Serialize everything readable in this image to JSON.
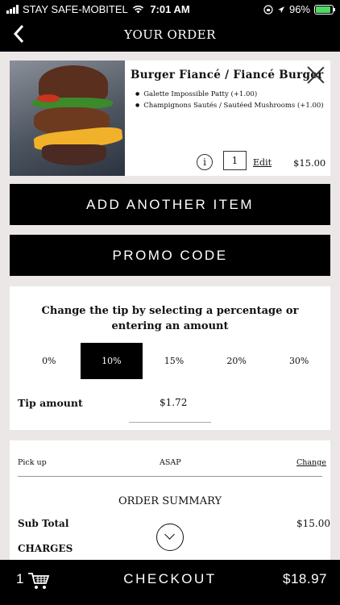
{
  "status_bar": {
    "carrier": "STAY SAFE-MOBITEL",
    "time": "7:01 AM",
    "battery": "96%",
    "battery_level": 0.96,
    "icons": [
      "signal-icon",
      "wifi-icon",
      "location-icon",
      "battery-icon"
    ]
  },
  "header": {
    "title": "YOUR ORDER",
    "back_icon": "back-chevron-icon"
  },
  "order_item": {
    "name": "Burger Fiancé  / Fiancé Burger",
    "options": [
      "Galette Impossible Patty (+1.00)",
      "Champignons Sautés / Sautéed Mushrooms (+1.00)"
    ],
    "quantity": "1",
    "edit_label": "Edit",
    "price": "$15.00",
    "info_glyph": "i"
  },
  "buttons": {
    "add_item": "ADD ANOTHER ITEM",
    "promo": "PROMO CODE"
  },
  "tip": {
    "heading": "Change the tip by selecting a percentage or entering an amount",
    "options": [
      "0%",
      "10%",
      "15%",
      "20%",
      "30%"
    ],
    "selected": "10%",
    "amount_label": "Tip amount",
    "amount_value": "$1.72"
  },
  "pickup": {
    "label": "Pick up",
    "value": "ASAP",
    "change_label": "Change"
  },
  "summary": {
    "title": "ORDER SUMMARY",
    "subtotal_label": "Sub Total",
    "subtotal_value": "$15.00",
    "charges_label": "CHARGES"
  },
  "checkout": {
    "cart_count": "1",
    "label": "CHECKOUT",
    "total": "$18.97"
  },
  "colors": {
    "background": "#ece7e7",
    "primary": "#000000",
    "card": "#ffffff",
    "battery_green": "#4cd964"
  }
}
